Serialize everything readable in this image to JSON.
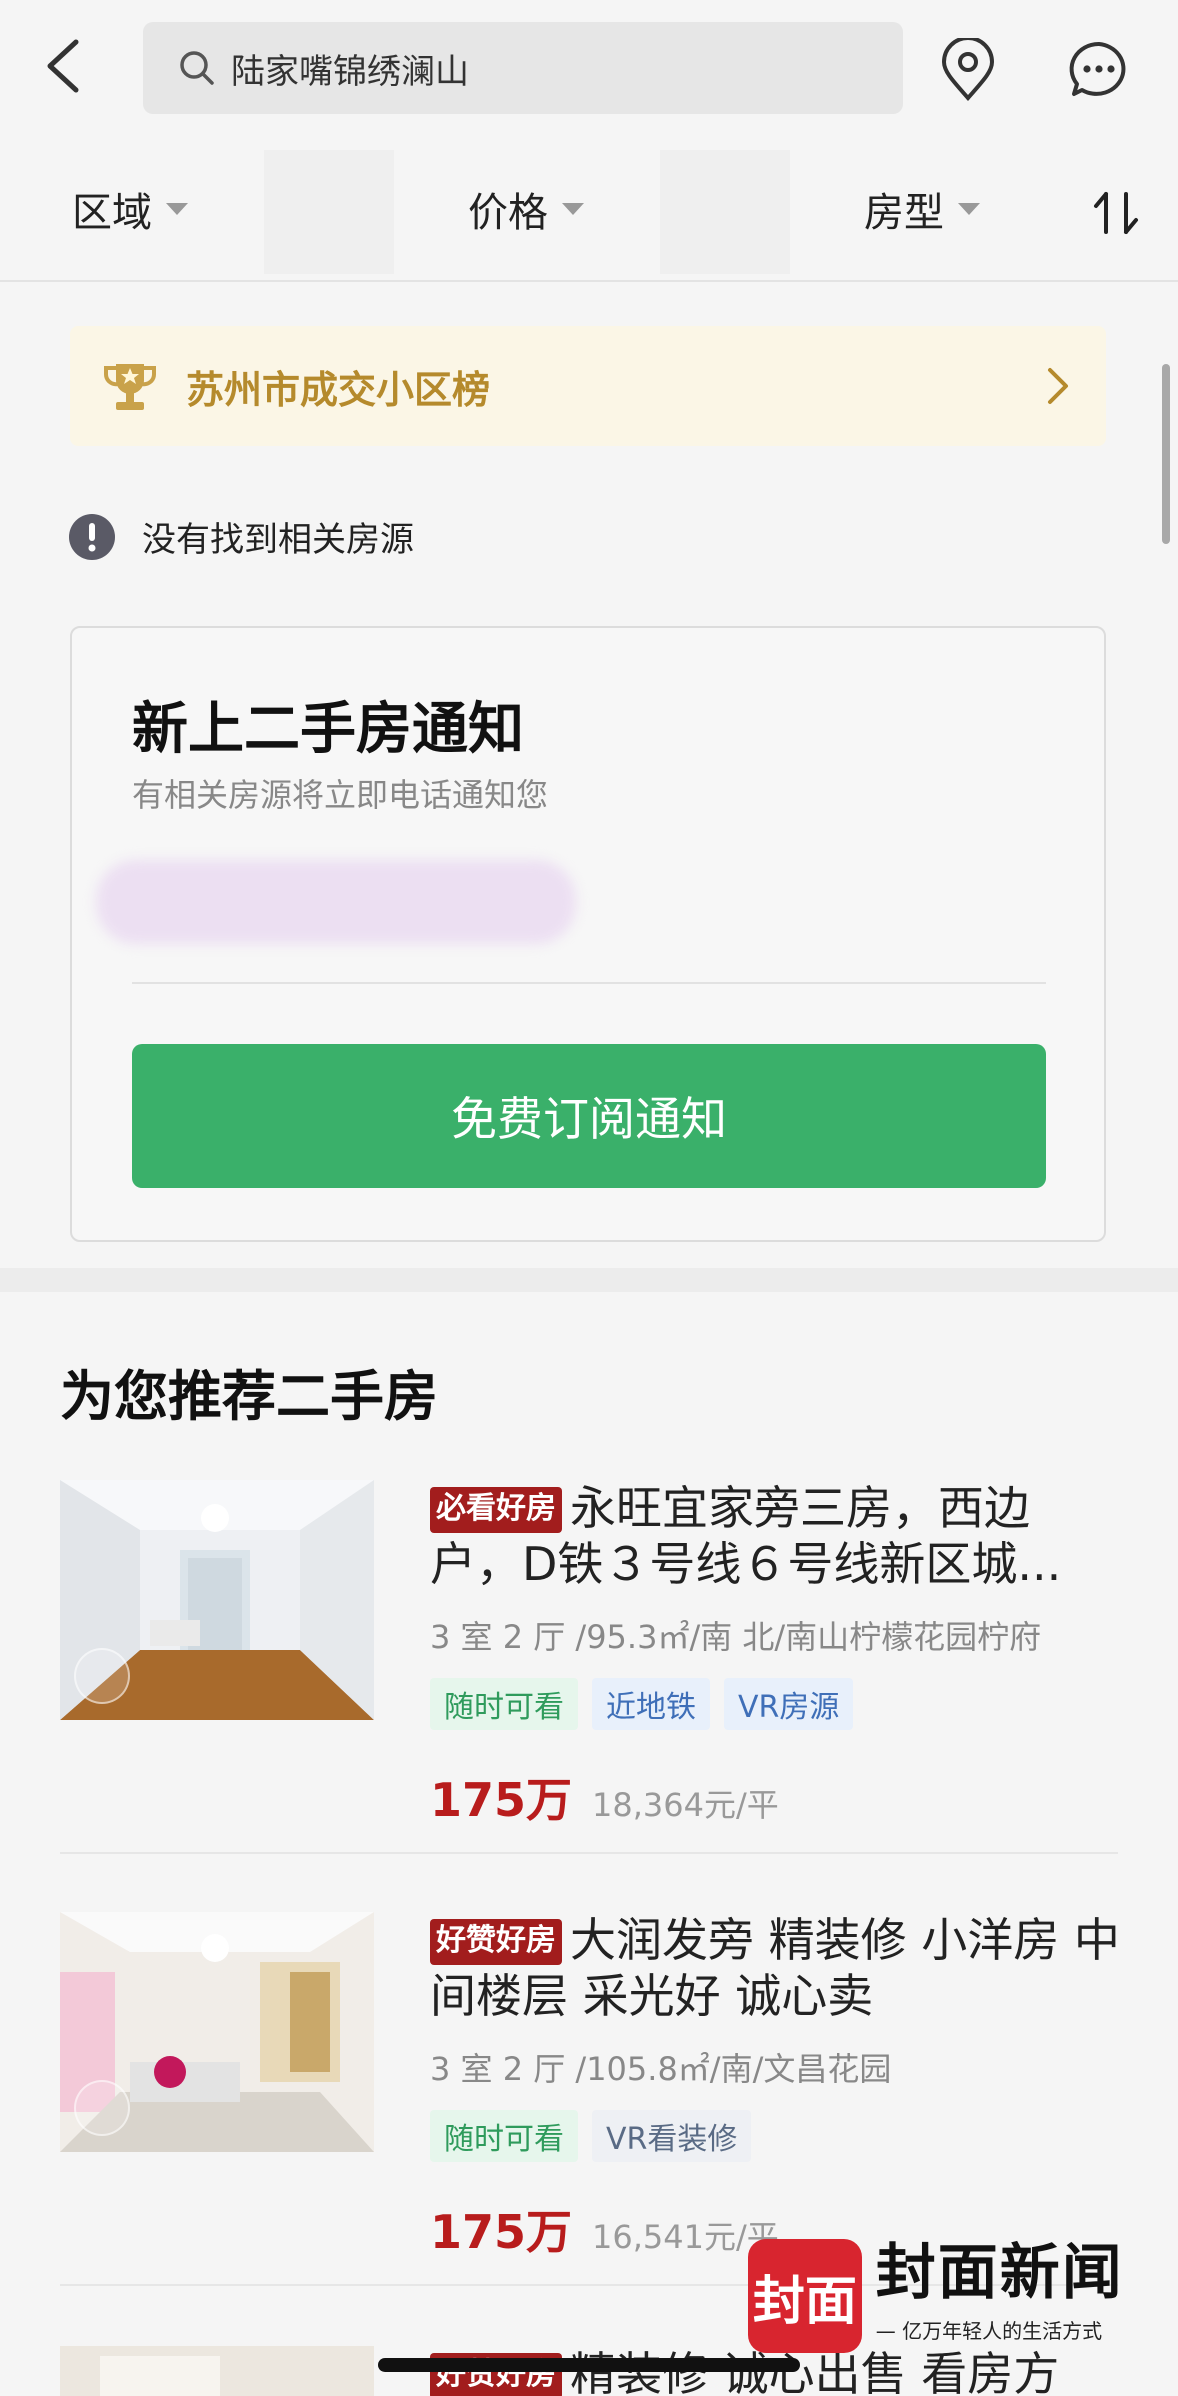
{
  "search": {
    "query": "陆家嘴锦绣澜山"
  },
  "filters": {
    "area": "区域",
    "price": "价格",
    "layout": "房型"
  },
  "rank_banner": {
    "label": "苏州市成交小区榜"
  },
  "empty_state": {
    "message": "没有找到相关房源"
  },
  "notify_card": {
    "title": "新上二手房通知",
    "subtitle": "有相关房源将立即电话通知您",
    "button": "免费订阅通知"
  },
  "recommend": {
    "heading": "为您推荐二手房",
    "listings": [
      {
        "badge": "必看好房",
        "title": "永旺宜家旁三房，西边户，D铁３号线６号线新区城...",
        "meta": "3 室 2 厅 /95.3㎡/南 北/南山柠檬花园柠府",
        "tags": [
          "随时可看",
          "近地铁",
          "VR房源"
        ],
        "price": "175万",
        "unit_price": "18,364元/平"
      },
      {
        "badge": "好赞好房",
        "title": "大润发旁 精装修 小洋房 中间楼层 采光好 诚心卖",
        "meta": "3 室 2 厅 /105.8㎡/南/文昌花园",
        "tags": [
          "随时可看",
          "VR看装修"
        ],
        "price": "175万",
        "unit_price": "16,541元/平"
      },
      {
        "badge": "好赞好房",
        "title": "精装修 诚心出售 看房方",
        "meta": "",
        "tags": [],
        "price": "",
        "unit_price": ""
      }
    ]
  },
  "watermark": {
    "logo": "封面",
    "title": "封面新闻",
    "slogan": "— 亿万年轻人的生活方式 —"
  },
  "colors": {
    "accent_green": "#3ab06a",
    "price_red": "#b81c1c",
    "gold": "#b58a2c",
    "badge_red": "#a21d1d"
  }
}
